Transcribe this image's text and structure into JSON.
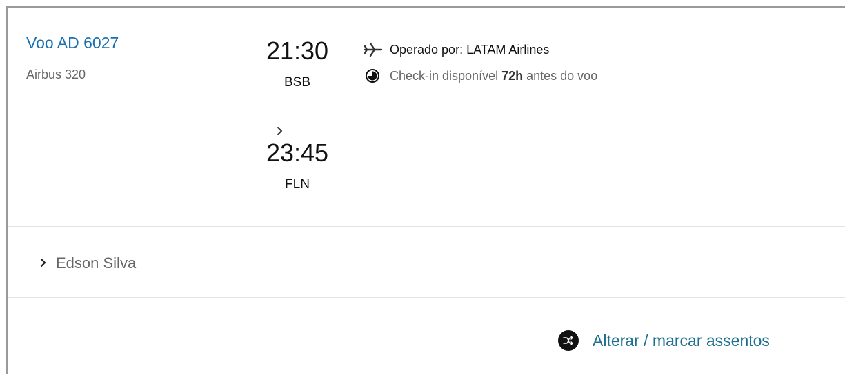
{
  "flight": {
    "number": "Voo AD 6027",
    "aircraft": "Airbus 320",
    "departure_time": "21:30",
    "departure_airport": "BSB",
    "arrival_time": "23:45",
    "arrival_airport": "FLN",
    "operated_by": "Operado por: LATAM Airlines",
    "checkin_prefix": "Check-in disponível ",
    "checkin_hours": "72h",
    "checkin_suffix": " antes do voo",
    "icons": {
      "operator": "airplane-icon",
      "checkin": "clock-icon",
      "route": "chevron-right-icon"
    }
  },
  "passenger": {
    "name": "Edson Silva",
    "icon": "chevron-right-icon"
  },
  "seats": {
    "label": "Alterar / marcar assentos",
    "icon": "shuffle-icon"
  },
  "colors": {
    "link_blue": "#1a6fb0",
    "seat_link": "#1d6f8f",
    "muted_text": "#666666",
    "border": "#9a9a9a",
    "divider": "#e3e3e3"
  }
}
